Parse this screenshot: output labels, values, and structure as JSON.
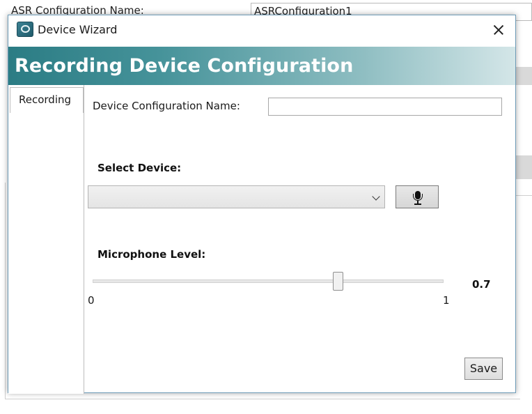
{
  "background_window": {
    "config_label": "ASR Configuration Name:",
    "config_value": "ASRConfiguration1"
  },
  "dialog": {
    "title": "Device Wizard",
    "banner_title": "Recording Device Configuration",
    "tabs": [
      {
        "label": "Recording",
        "selected": true
      }
    ],
    "device_config_name_label": "Device Configuration Name:",
    "device_config_name_value": "",
    "select_device_label": "Select Device:",
    "selected_device": "",
    "microphone_level_label": "Microphone Level:",
    "microphone_level": {
      "min": "0",
      "max": "1",
      "value_text": "0.7",
      "value": 0.7
    },
    "save_label": "Save"
  },
  "icons": {
    "app": "wizard-app-icon",
    "close": "close-icon",
    "dropdown": "chevron-down-icon",
    "microphone": "microphone-icon"
  },
  "colors": {
    "banner_start": "#2b7c84",
    "banner_end": "#d4e6e8",
    "window_border": "#6d9bb7"
  }
}
